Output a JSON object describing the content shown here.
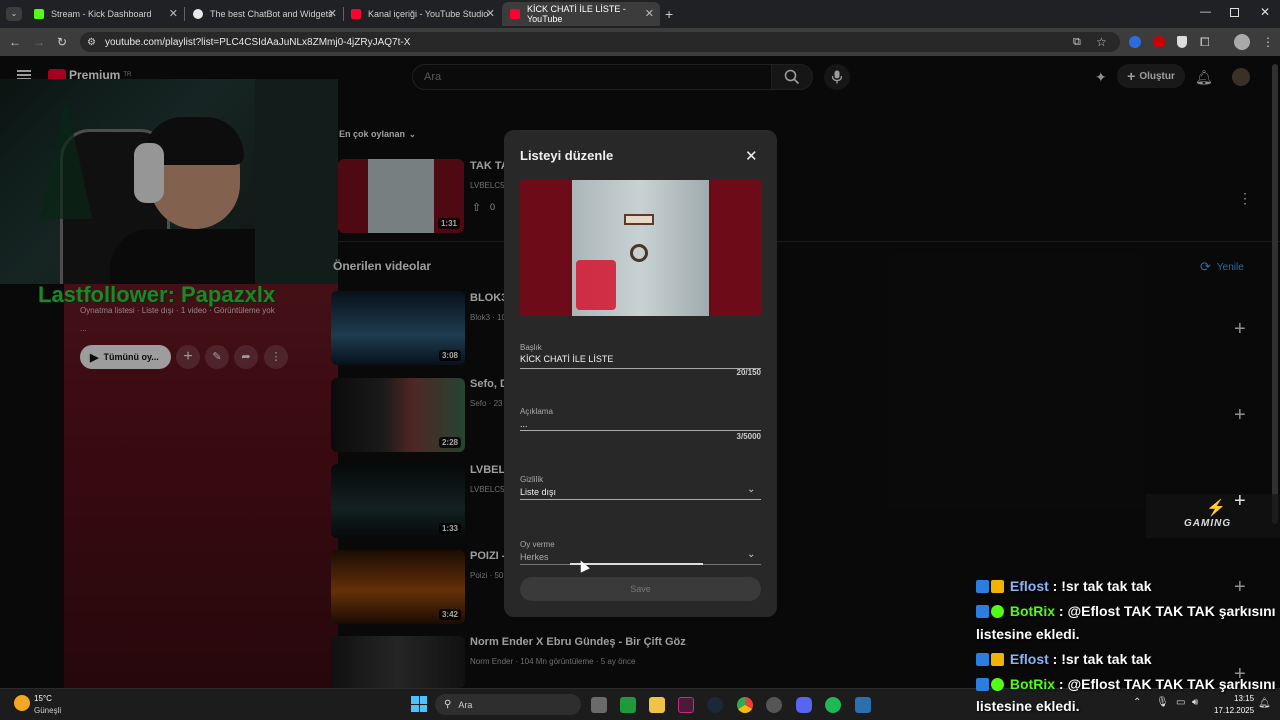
{
  "tabs": [
    {
      "label": "Stream - Kick Dashboard",
      "color": "#53fc18"
    },
    {
      "label": "The best ChatBot and Widgets",
      "color": "#e8e8e8"
    },
    {
      "label": "Kanal içeriği - YouTube Studio",
      "color": "#ff0033"
    },
    {
      "label": "KİCK CHATİ İLE LİSTE - YouTube",
      "color": "#ff0033"
    }
  ],
  "address_bar": {
    "url": "youtube.com/playlist?list=PLC4CSIdAaJuNLx8ZMmj0-4jZRyJAQ7t-X"
  },
  "yt_header": {
    "logo": "Premium",
    "logo_sup": "TR",
    "search_placeholder": "Ara",
    "create_label": "Oluştur"
  },
  "overlay": {
    "last_follower": "Lastfollower: Papazxlx"
  },
  "playlist_panel": {
    "meta": "Oynatma listesi · Liste dışı · 1 video · Görüntüleme yok",
    "desc": "...",
    "play_all": "Tümünü oy..."
  },
  "sort": {
    "label": "En çok oylanan"
  },
  "playlist_item": {
    "title": "TAK TA",
    "channel": "LVBELC5",
    "likes": "0",
    "duration": "1:31"
  },
  "recommended": {
    "heading": "Önerilen videolar",
    "refresh_label": "Yenile",
    "videos": [
      {
        "title": "BLOK3",
        "meta": "Blok3 · 10",
        "duration": "3:08"
      },
      {
        "title": "Sefo, D",
        "meta": "Sefo · 23",
        "duration": "2:28"
      },
      {
        "title": "LVBEL C",
        "meta": "LVBELC5",
        "duration": "1:33"
      },
      {
        "title": "POIZI -",
        "meta": "Poizi · 50",
        "duration": "3:42"
      },
      {
        "title": "Norm Ender X Ebru Gündeş - Bir Çift Göz",
        "meta": "Norm Ender · 104 Mn görüntüleme · 5 ay önce",
        "duration": ""
      }
    ]
  },
  "dialog": {
    "title": "Listeyi düzenle",
    "title_field": {
      "label": "Başlık",
      "value": "KİCK CHATİ İLE LİSTE",
      "counter": "20/150"
    },
    "desc_field": {
      "label": "Açıklama",
      "value": "...",
      "counter": "3/5000"
    },
    "privacy_field": {
      "label": "Gizlilik",
      "value": "Liste dışı"
    },
    "voting_field": {
      "label": "Oy verme",
      "value": "Herkes"
    },
    "save_label": "Save"
  },
  "chat": [
    {
      "user": "Eflost",
      "message": " : !sr tak tak tak",
      "user_color": "#8ab4f8"
    },
    {
      "user": "BotRix",
      "message": " : @Eflost TAK TAK TAK şarkısını ç",
      "user_color": "#53fc18"
    },
    {
      "user": "",
      "message": "listesine ekledi.",
      "user_color": "#ffffff"
    },
    {
      "user": "Eflost",
      "message": " : !sr tak tak tak",
      "user_color": "#8ab4f8"
    },
    {
      "user": "BotRix",
      "message": " : @Eflost TAK TAK TAK şarkısını ç",
      "user_color": "#53fc18"
    },
    {
      "user": "",
      "message": "listesine ekledi.",
      "user_color": "#ffffff"
    }
  ],
  "gaming_logo": "GAMING",
  "taskbar": {
    "weather_temp": "15°C",
    "weather_desc": "Güneşli",
    "search_label": "Ara",
    "time": "13:15",
    "date": "17.12.2025"
  }
}
